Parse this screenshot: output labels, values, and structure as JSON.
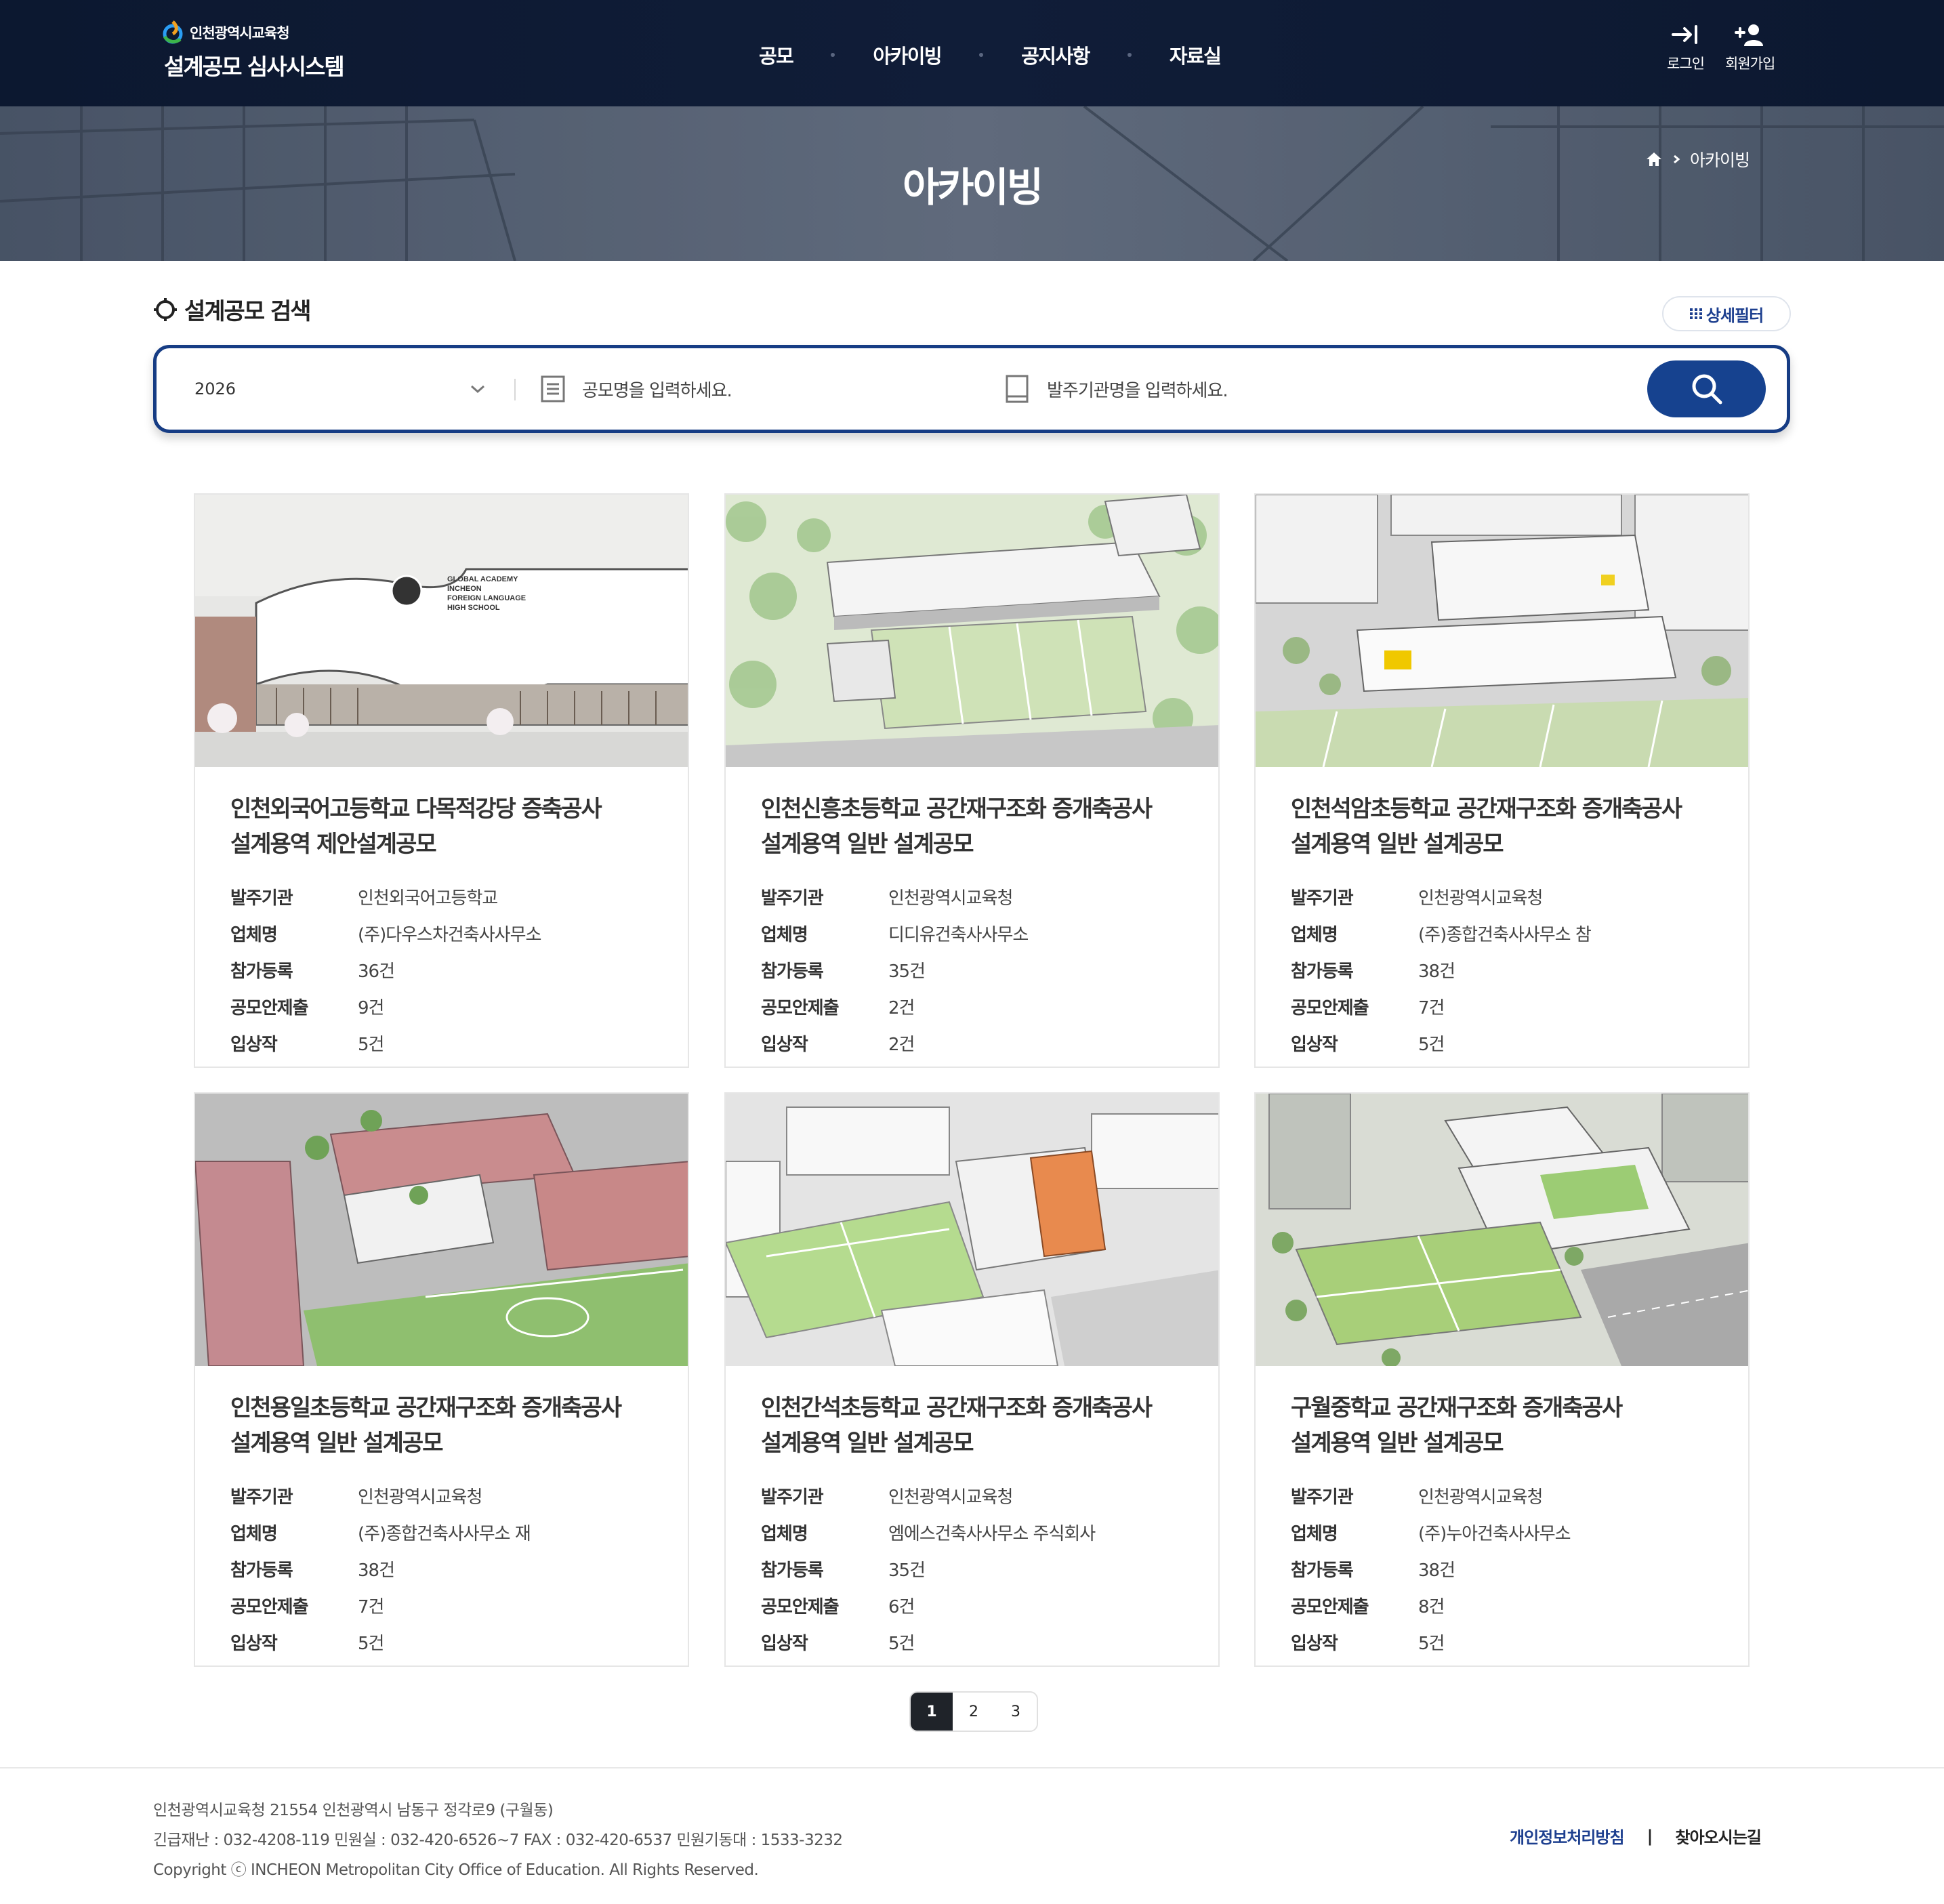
{
  "header": {
    "org_name": "인천광역시교육청",
    "system_name": "설계공모 심사시스템",
    "nav": [
      "공모",
      "아카이빙",
      "공지사항",
      "자료실"
    ],
    "login_label": "로그인",
    "signup_label": "회원가입"
  },
  "hero": {
    "title": "아카이빙",
    "breadcrumb_current": "아카이빙"
  },
  "search": {
    "section_title": "설계공모 검색",
    "detail_filter_label": "상세필터",
    "year_value": "2026",
    "title_placeholder": "공모명을 입력하세요.",
    "org_placeholder": "발주기관명을 입력하세요."
  },
  "labels": {
    "org": "발주기관",
    "company": "업체명",
    "registered": "참가등록",
    "submitted": "공모안제출",
    "awarded": "입상작"
  },
  "cards": [
    {
      "title_line1": "인천외국어고등학교 다목적강당 증축공사",
      "title_line2": "설계용역 제안설계공모",
      "org": "인천외국어고등학교",
      "company": "(주)다우스차건축사사무소",
      "registered": "36건",
      "submitted": "9건",
      "awarded": "5건",
      "thumb_sign": [
        "GLOBAL ACADEMY",
        "INCHEON",
        "FOREIGN LANGUAGE",
        "HIGH SCHOOL"
      ]
    },
    {
      "title_line1": "인천신흥초등학교 공간재구조화 증개축공사",
      "title_line2": "설계용역 일반 설계공모",
      "org": "인천광역시교육청",
      "company": "디디유건축사사무소",
      "registered": "35건",
      "submitted": "2건",
      "awarded": "2건"
    },
    {
      "title_line1": "인천석암초등학교 공간재구조화 증개축공사",
      "title_line2": "설계용역 일반 설계공모",
      "org": "인천광역시교육청",
      "company": "(주)종합건축사사무소 참",
      "registered": "38건",
      "submitted": "7건",
      "awarded": "5건"
    },
    {
      "title_line1": "인천용일초등학교 공간재구조화 증개축공사",
      "title_line2": "설계용역 일반 설계공모",
      "org": "인천광역시교육청",
      "company": "(주)종합건축사사무소 재",
      "registered": "38건",
      "submitted": "7건",
      "awarded": "5건"
    },
    {
      "title_line1": "인천간석초등학교 공간재구조화 증개축공사",
      "title_line2": "설계용역 일반 설계공모",
      "org": "인천광역시교육청",
      "company": "엠에스건축사사무소 주식회사",
      "registered": "35건",
      "submitted": "6건",
      "awarded": "5건"
    },
    {
      "title_line1": "구월중학교 공간재구조화 증개축공사",
      "title_line2": "설계용역 일반 설계공모",
      "org": "인천광역시교육청",
      "company": "(주)누아건축사사무소",
      "registered": "38건",
      "submitted": "8건",
      "awarded": "5건"
    }
  ],
  "pagination": {
    "pages": [
      "1",
      "2",
      "3"
    ],
    "current": "1"
  },
  "footer": {
    "address": "인천광역시교육청 21554 인천광역시 남동구 정각로9 (구월동)",
    "contacts": "긴급재난 : 032-4208-119 민원실 : 032-420-6526~7 FAX : 032-420-6537 민원기동대 : 1533-3232",
    "copyright": "Copyright ⓒ INCHEON Metropolitan City Office of Education. All Rights Reserved.",
    "privacy_label": "개인정보처리방침",
    "separator": "|",
    "directions_label": "찾아오시는길"
  },
  "colors": {
    "header_bg": "#101d38",
    "accent": "#16428f",
    "privacy_link": "#1d3f8f"
  },
  "icons": [
    "login-icon",
    "signup-icon",
    "home-icon",
    "chevron-right-icon",
    "search-icon",
    "grid-icon",
    "chevron-down-icon",
    "document-icon",
    "book-icon",
    "circle-target-icon"
  ]
}
